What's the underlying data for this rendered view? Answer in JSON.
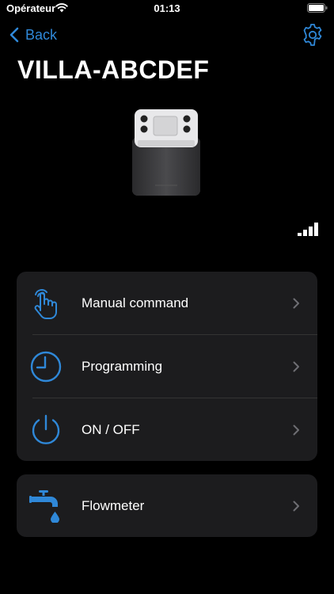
{
  "status_bar": {
    "carrier": "Opérateur",
    "time": "01:13"
  },
  "nav": {
    "back_label": "Back"
  },
  "device": {
    "name": "VILLA-ABCDEF"
  },
  "menu": {
    "items": [
      {
        "label": "Manual command",
        "icon": "hand-tap-icon"
      },
      {
        "label": "Programming",
        "icon": "clock-icon"
      },
      {
        "label": "ON / OFF",
        "icon": "power-icon"
      }
    ]
  },
  "extra": {
    "items": [
      {
        "label": "Flowmeter",
        "icon": "water-tap-icon"
      }
    ]
  },
  "colors": {
    "accent": "#2f88d8",
    "background": "#000000",
    "card": "#1c1c1e"
  }
}
